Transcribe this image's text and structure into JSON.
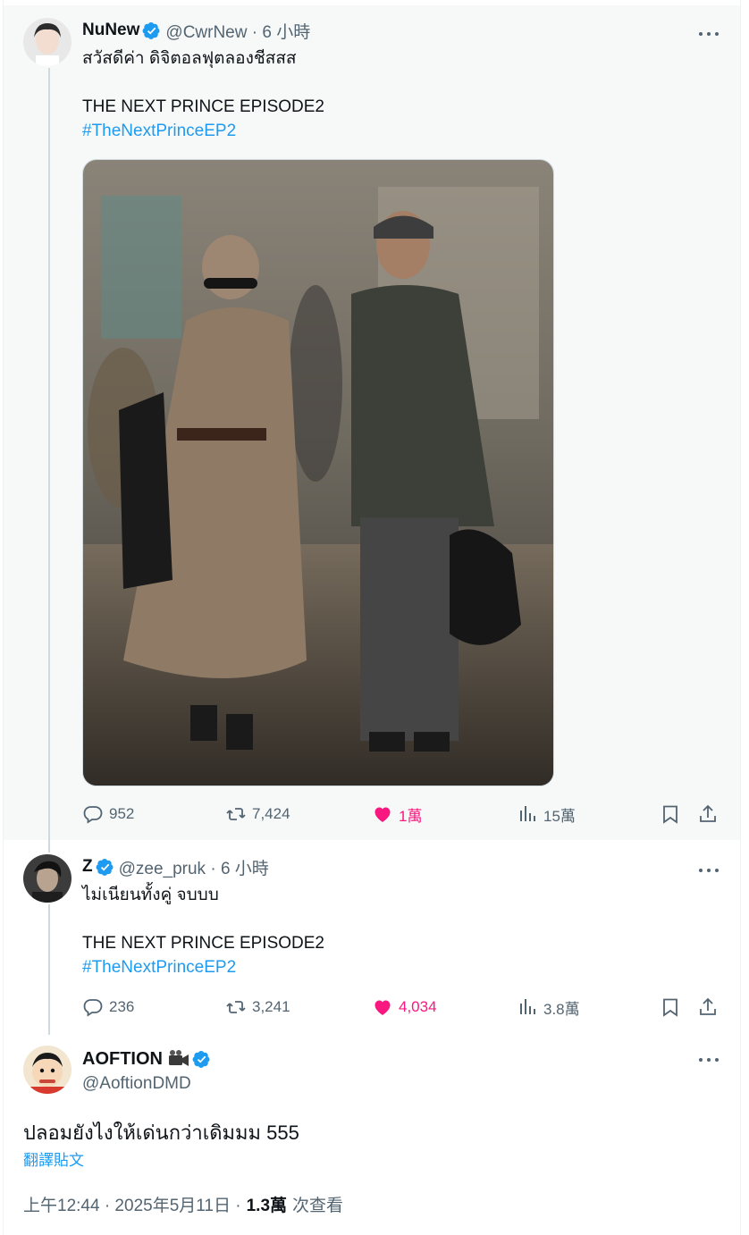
{
  "tweets": [
    {
      "name": "NuNew",
      "handle": "@CwrNew · 6 小時",
      "line1": "สวัสดีค่า ดิจิตอลฟุตลองชีสสส",
      "line2": "THE NEXT PRINCE EPISODE2",
      "hashtag": "#TheNextPrinceEP2",
      "replies": "952",
      "retweets": "7,424",
      "likes": "1萬",
      "views": "15萬"
    },
    {
      "name": "Z",
      "handle": "@zee_pruk · 6 小時",
      "line1": "ไม่เนียนทั้งคู่ จบบบ",
      "line2": "THE NEXT PRINCE EPISODE2",
      "hashtag": "#TheNextPrinceEP2",
      "replies": "236",
      "retweets": "3,241",
      "likes": "4,034",
      "views": "3.8萬"
    }
  ],
  "main_tweet": {
    "name": "AOFTION",
    "handle": "@AoftionDMD",
    "text": "ปลอมยังไงให้เด่นกว่าเดิมมม 555",
    "translate": "翻譯貼文",
    "timestamp": "上午12:44 · 2025年5月11日 · ",
    "views": "1.3萬",
    "views_label": "次查看"
  },
  "colors": {
    "accent": "#1d9bf0",
    "like": "#f91880",
    "muted": "#536471",
    "highlight_bg": "#f7f9f9"
  },
  "icons": [
    "verified-badge-icon",
    "more-icon",
    "reply-icon",
    "retweet-icon",
    "heart-icon",
    "views-icon",
    "bookmark-icon",
    "share-icon",
    "camera-icon"
  ]
}
